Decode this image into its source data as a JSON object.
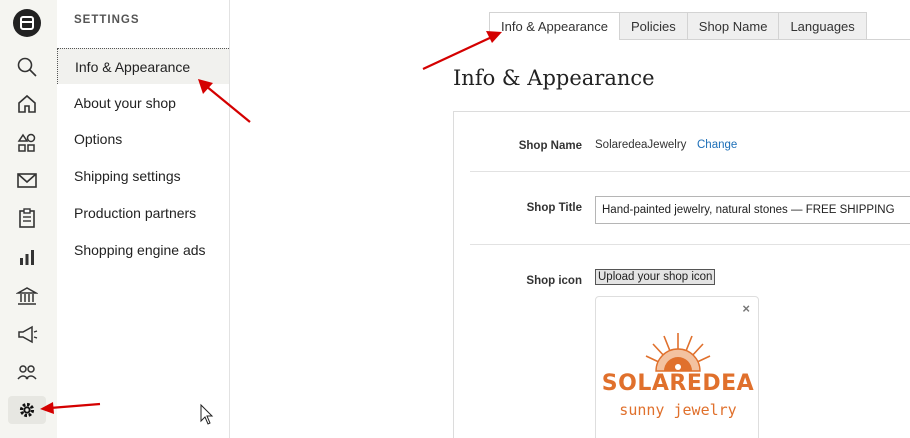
{
  "sidebar": {
    "title": "SETTINGS",
    "items": [
      {
        "label": "Info & Appearance"
      },
      {
        "label": "About your shop"
      },
      {
        "label": "Options"
      },
      {
        "label": "Shipping settings"
      },
      {
        "label": "Production partners"
      },
      {
        "label": "Shopping engine ads"
      }
    ]
  },
  "rail": {
    "icons": [
      "shop-logo-icon",
      "search-icon",
      "home-icon",
      "listings-icon",
      "messages-icon",
      "orders-icon",
      "stats-icon",
      "finances-icon",
      "marketing-icon",
      "community-icon",
      "settings-icon"
    ]
  },
  "tabs": [
    {
      "label": "Info & Appearance"
    },
    {
      "label": "Policies"
    },
    {
      "label": "Shop Name"
    },
    {
      "label": "Languages"
    }
  ],
  "main": {
    "title": "Info & Appearance",
    "shop_name_label": "Shop Name",
    "shop_name_value": "SolaredeaJewelry",
    "change_label": "Change",
    "shop_title_label": "Shop Title",
    "shop_title_value": "Hand-painted jewelry, natural stones — FREE SHIPPING",
    "shop_icon_label": "Shop icon",
    "upload_label": "Upload your shop icon",
    "close_symbol": "×",
    "logo": {
      "main": "SOLAREDEA",
      "sub": "sunny jewelry",
      "color": "#e0702c"
    }
  },
  "colors": {
    "annotation_arrow": "#d40000",
    "link": "#1d6fb8"
  }
}
